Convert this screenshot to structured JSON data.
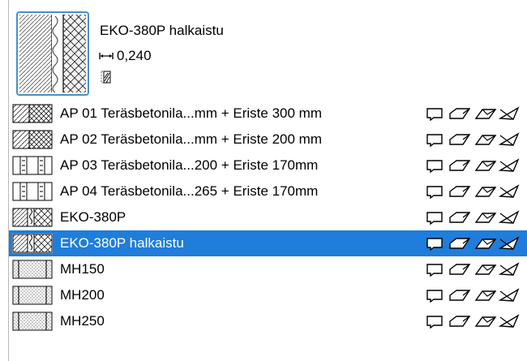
{
  "header": {
    "title": "EKO-380P halkaistu",
    "thickness": "0,240",
    "thickness_icon": "thickness-arrow-icon",
    "structure_icon": "structure-type-icon",
    "preview_icon": "composite-preview-icon"
  },
  "list": {
    "items": [
      {
        "label": "AP 01 Teräsbetonila...mm + Eriste 300 mm",
        "thumb": "a",
        "selected": false
      },
      {
        "label": "AP 02 Teräsbetonila...mm + Eriste 200 mm",
        "thumb": "a",
        "selected": false
      },
      {
        "label": "AP 03 Teräsbetonila...200 + Eriste 170mm",
        "thumb": "b",
        "selected": false
      },
      {
        "label": "AP 04 Teräsbetonila...265 + Eriste 170mm",
        "thumb": "b",
        "selected": false
      },
      {
        "label": "EKO-380P",
        "thumb": "c",
        "selected": false
      },
      {
        "label": "EKO-380P halkaistu",
        "thumb": "c",
        "selected": true
      },
      {
        "label": "MH150",
        "thumb": "d",
        "selected": false
      },
      {
        "label": "MH200",
        "thumb": "d",
        "selected": false
      },
      {
        "label": "MH250",
        "thumb": "d",
        "selected": false
      }
    ],
    "action_icons": [
      "wall-shape-icon",
      "slab-shape-icon",
      "roof-shape-icon",
      "shell-shape-icon"
    ]
  },
  "colors": {
    "selection": "#1f7ddb",
    "selection_text": "#ffffff",
    "preview_border": "#4a90c8"
  }
}
